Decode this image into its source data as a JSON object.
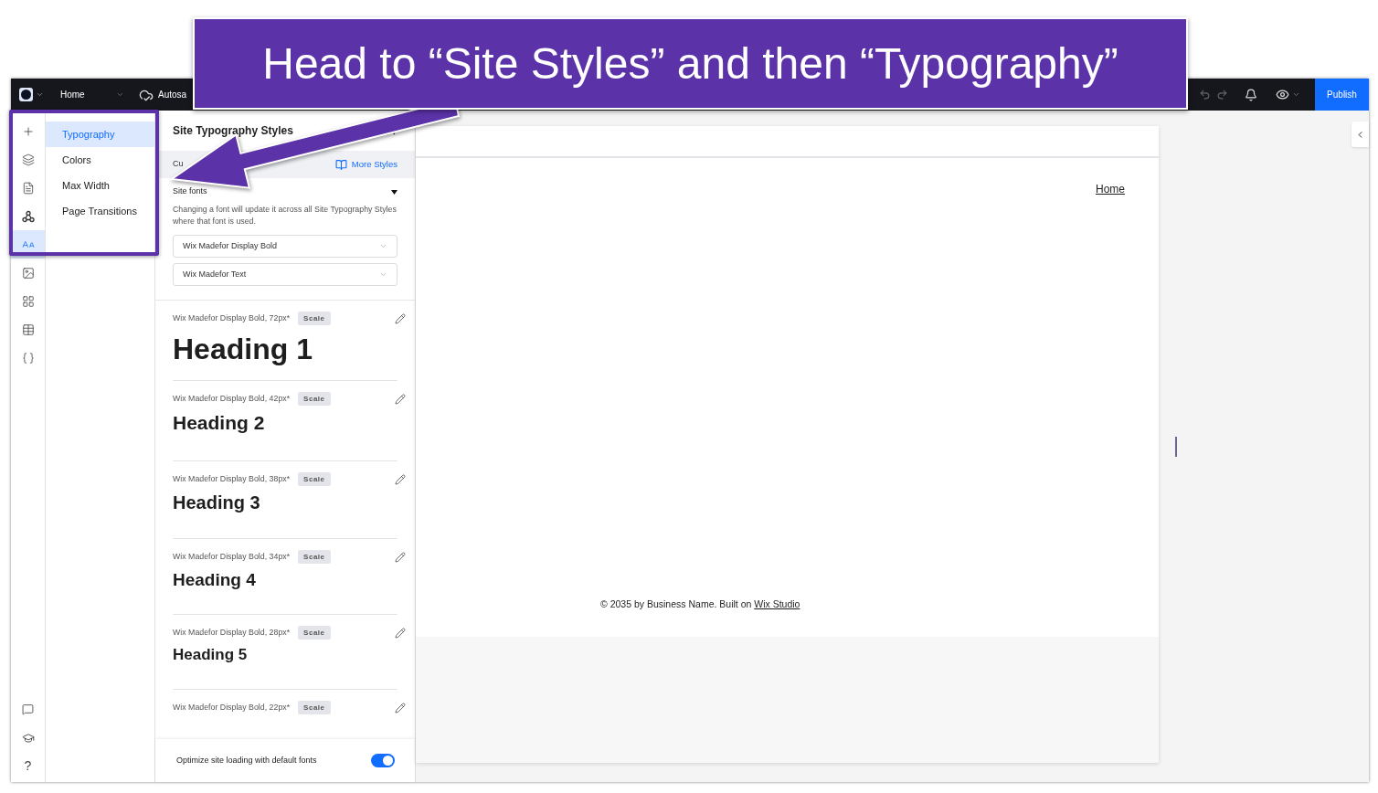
{
  "annotation": {
    "text": "Head to “Site Styles” and then “Typography”"
  },
  "top_bar": {
    "page": "Home",
    "autosave": "Autosa",
    "publish": "Publish"
  },
  "rail": [
    {
      "selected": false
    },
    {
      "selected": false
    },
    {
      "selected": false
    },
    {
      "selected": false
    },
    {
      "selected": true
    },
    {
      "selected": false
    },
    {
      "selected": false
    },
    {
      "selected": false
    },
    {
      "selected": false
    }
  ],
  "rail_help": "?",
  "menu": [
    {
      "label": "Typography",
      "selected": true
    },
    {
      "label": "Colors",
      "selected": false
    },
    {
      "label": "Max Width",
      "selected": false
    },
    {
      "label": "Page Transitions",
      "selected": false
    }
  ],
  "panel": {
    "title": "Site Typography Styles",
    "current_label": "Cu",
    "more_styles": "More Styles",
    "site_fonts": "Site fonts",
    "note": "Changing a font will update it across all Site Typography Styles where that font is used.",
    "fonts": [
      "Wix Madefor Display Bold",
      "Wix Madefor Text"
    ],
    "styles": [
      {
        "font": "Wix Madefor Display Bold,",
        "size": "72px*",
        "badge": "Scale",
        "name": "Heading 1"
      },
      {
        "font": "Wix Madefor Display Bold,",
        "size": "42px*",
        "badge": "Scale",
        "name": "Heading 2"
      },
      {
        "font": "Wix Madefor Display Bold,",
        "size": "38px*",
        "badge": "Scale",
        "name": "Heading 3"
      },
      {
        "font": "Wix Madefor Display Bold,",
        "size": "34px*",
        "badge": "Scale",
        "name": "Heading 4"
      },
      {
        "font": "Wix Madefor Display Bold,",
        "size": "28px*",
        "badge": "Scale",
        "name": "Heading 5"
      },
      {
        "font": "Wix Madefor Display Bold,",
        "size": "22px*",
        "badge": "Scale"
      }
    ],
    "optimize": {
      "label": "Optimize site loading with default fonts",
      "on": true
    }
  },
  "canvas": {
    "nav_link": "Home",
    "footer_text": "© 2035 by Business Name. Built on ",
    "footer_link": "Wix Studio"
  }
}
